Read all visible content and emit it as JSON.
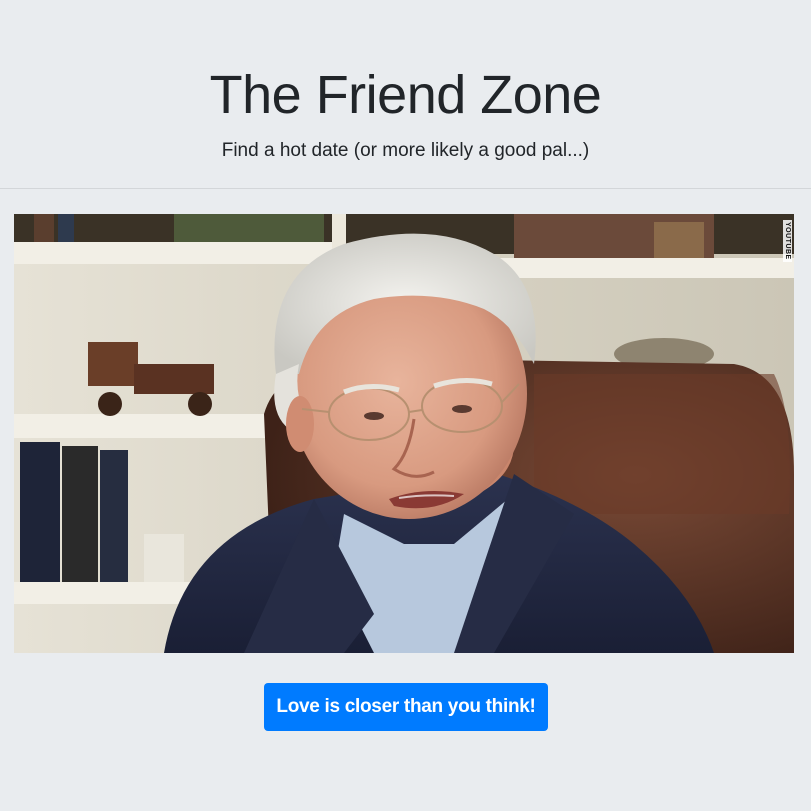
{
  "header": {
    "title": "The Friend Zone",
    "subtitle": "Find a hot date (or more likely a good pal...)"
  },
  "video": {
    "watermark": "YOUTUBE",
    "subject": "older-man-portrait"
  },
  "cta": {
    "label": "Love is closer than you think!"
  },
  "colors": {
    "background": "#e9ecef",
    "primary": "#007bff",
    "text": "#212529"
  }
}
